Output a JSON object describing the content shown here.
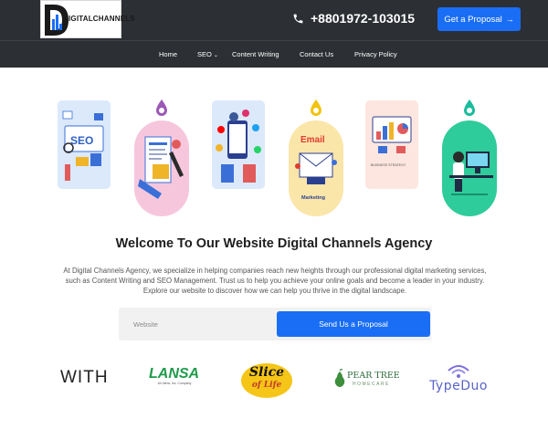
{
  "header": {
    "logo_text": "DIGITALCHANNELS",
    "phone": "+8801972-103015",
    "cta_label": "Get a Proposal",
    "cta_arrow": "→"
  },
  "nav": {
    "items": [
      {
        "label": "Home"
      },
      {
        "label": "SEO",
        "has_dropdown": true
      },
      {
        "label": "Content Writing"
      },
      {
        "label": "Contact Us"
      },
      {
        "label": "Privacy Policy"
      }
    ]
  },
  "illustrations": {
    "email_label": "Email",
    "marketing_label": "Marketing",
    "seo_label": "SEO",
    "business_strategy_label": "BUSINESS STRATEGY"
  },
  "welcome": {
    "title": "Welcome To Our Website Digital Channels Agency",
    "body": "At Digital Channels Agency, we specialize in helping companies reach new heights through our professional digital marketing services, such as Content Writing and SEO Management. Trust us to help you achieve your online goals and become a leader in your industry. Explore our website to discover how we can help you thrive in the digital landscape."
  },
  "form": {
    "website_placeholder": "Website",
    "submit_label": "Send Us a Proposal"
  },
  "clients": {
    "logo1": "WITH",
    "logo2": "LANSA",
    "logo2_sub": "An Idera, Inc. Company",
    "logo3_line1": "Slice",
    "logo3_line2": "of Life",
    "logo4_line1": "PEAR TREE",
    "logo4_line2": "HOMECARE",
    "logo5": "TypeDuo"
  },
  "colors": {
    "header_bg": "#2c2f33",
    "accent_blue": "#1a6ef5",
    "drop_purple": "#9b59b6",
    "drop_yellow": "#f1c40f",
    "drop_teal": "#1abc9c"
  }
}
